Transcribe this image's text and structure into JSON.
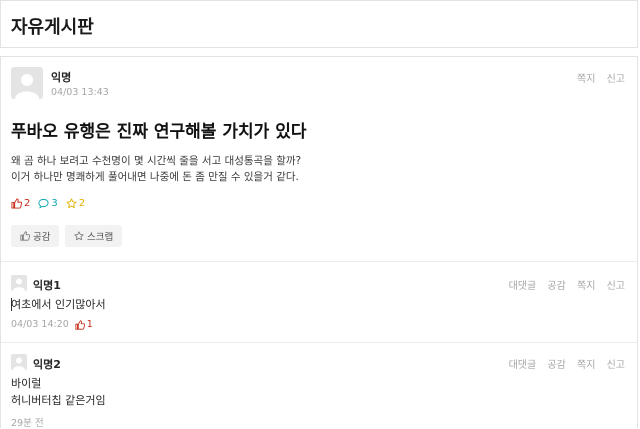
{
  "board": {
    "title": "자유게시판"
  },
  "post": {
    "author": "익명",
    "time": "04/03 13:43",
    "actions": {
      "message": "쪽지",
      "report": "신고"
    },
    "title": "푸바오 유행은 진짜 연구해볼 가치가 있다",
    "body": [
      "왜 곰 하나 보려고 수천명이 몇 시간씩 줄을 서고 대성통곡을 할까?",
      "이거 하나만 명쾌하게 풀어내면 나중에 돈 좀 만질 수 있을거 같다."
    ],
    "counts": {
      "likes": "2",
      "comments": "3",
      "scraps": "2"
    },
    "buttons": {
      "like": "공감",
      "scrap": "스크랩"
    }
  },
  "comments": [
    {
      "author": "익명1",
      "actions": [
        "대댓글",
        "공감",
        "쪽지",
        "신고"
      ],
      "text": [
        "여초에서 인기많아서"
      ],
      "time": "04/03 14:20",
      "likes": "1"
    },
    {
      "author": "익명2",
      "actions": [
        "대댓글",
        "공감",
        "쪽지",
        "신고"
      ],
      "text": [
        "바이럴",
        "허니버터칩 같은거임"
      ],
      "time": "29분 전"
    }
  ],
  "icons": {
    "avatar": "avatar-icon",
    "like": "thumbs-up-icon",
    "comment": "speech-bubble-icon",
    "scrap": "star-icon"
  },
  "colors": {
    "like": "#c62917",
    "comment": "#0ca5af",
    "scrap": "#e2b100"
  }
}
